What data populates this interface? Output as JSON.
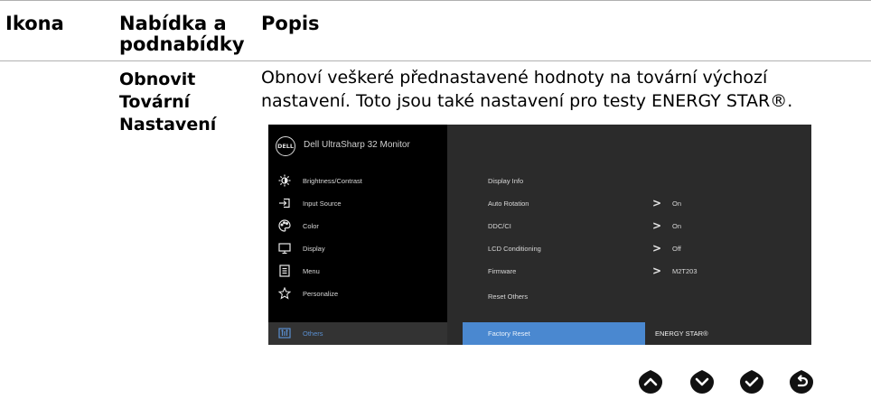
{
  "table": {
    "headers": {
      "icon": "Ikona",
      "menu_line1": "Nabídka a",
      "menu_line2": "podnabídky",
      "desc": "Popis"
    },
    "row": {
      "label_lines": [
        "Obnovit",
        "Tovární",
        "Nastavení"
      ],
      "description_lines": [
        "Obnoví veškeré přednastavené hodnoty na tovární výchozí",
        "nastavení. Toto jsou také nastavení pro testy ENERGY STAR®."
      ]
    }
  },
  "osd": {
    "logo": "DELL",
    "model": "Dell UltraSharp 32 Monitor",
    "menu": [
      {
        "label": "Brightness/Contrast",
        "icon": "brightness-icon"
      },
      {
        "label": "Input Source",
        "icon": "input-source-icon"
      },
      {
        "label": "Color",
        "icon": "color-palette-icon"
      },
      {
        "label": "Display",
        "icon": "display-icon"
      },
      {
        "label": "Menu",
        "icon": "menu-icon"
      },
      {
        "label": "Personalize",
        "icon": "star-icon"
      },
      {
        "label": "Others",
        "icon": "others-icon",
        "active": true
      }
    ],
    "submenu": [
      {
        "label": "Display Info",
        "value": ""
      },
      {
        "label": "Auto Rotation",
        "value": "On"
      },
      {
        "label": "DDC/CI",
        "value": "On"
      },
      {
        "label": "LCD Conditioning",
        "value": "Off"
      },
      {
        "label": "Firmware",
        "value": "M2T203"
      },
      {
        "label": "Reset Others",
        "value": ""
      },
      {
        "label": "Factory Reset",
        "value": "ENERGY STAR®",
        "selected": true
      }
    ]
  },
  "buttons": [
    {
      "name": "up-button",
      "icon": "chevron-up-icon"
    },
    {
      "name": "down-button",
      "icon": "chevron-down-icon"
    },
    {
      "name": "ok-button",
      "icon": "checkmark-icon"
    },
    {
      "name": "back-button",
      "icon": "back-arrow-icon"
    }
  ],
  "colors": {
    "highlight": "#4a88d0",
    "osd_bg": "#000000",
    "osd_panel": "#2b2b2b",
    "active_text": "#5a8fd0"
  }
}
